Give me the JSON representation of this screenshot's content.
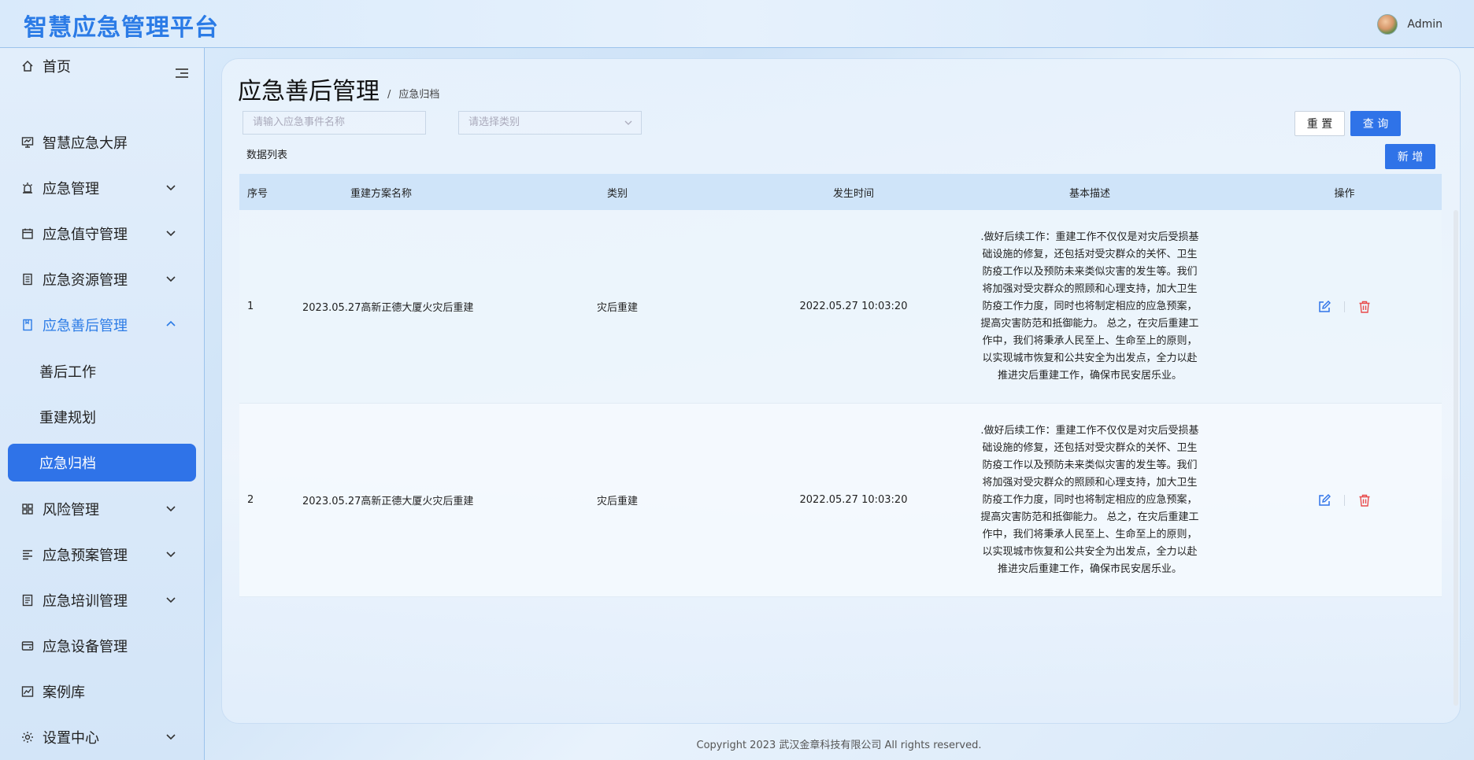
{
  "header": {
    "title": "智慧应急管理平台",
    "user": "Admin"
  },
  "sidebar": {
    "items": [
      {
        "label": "首页",
        "icon": "home-icon"
      },
      {
        "label": "智慧应急大屏",
        "icon": "dashboard-icon"
      },
      {
        "label": "应急管理",
        "icon": "alarm-icon"
      },
      {
        "label": "应急值守管理",
        "icon": "calendar-icon"
      },
      {
        "label": "应急资源管理",
        "icon": "document-icon"
      },
      {
        "label": "应急善后管理",
        "icon": "file-icon"
      },
      {
        "label": "风险管理",
        "icon": "grid-icon"
      },
      {
        "label": "应急预案管理",
        "icon": "list-icon"
      },
      {
        "label": "应急培训管理",
        "icon": "training-icon"
      },
      {
        "label": "应急设备管理",
        "icon": "device-icon"
      },
      {
        "label": "案例库",
        "icon": "chart-icon"
      },
      {
        "label": "设置中心",
        "icon": "gear-icon"
      }
    ],
    "sub_items": [
      "善后工作",
      "重建规划",
      "应急归档"
    ]
  },
  "main": {
    "title": "应急善后管理",
    "breadcrumb": "应急归档",
    "search_placeholder": "请输入应急事件名称",
    "type_placeholder": "请选择类别",
    "reset_label": "重 置",
    "query_label": "查 询",
    "add_label": "新 增",
    "list_label": "数据列表"
  },
  "table": {
    "headers": [
      "序号",
      "重建方案名称",
      "类别",
      "发生时间",
      "基本描述",
      "操作"
    ],
    "rows": [
      {
        "index": "1",
        "name": "2023.05.27高新正德大厦火灾后重建",
        "type": "灾后重建",
        "time": "2022.05.27 10:03:20",
        "desc": ".做好后续工作：重建工作不仅仅是对灾后受损基础设施的修复，还包括对受灾群众的关怀、卫生防疫工作以及预防未来类似灾害的发生等。我们将加强对受灾群众的照顾和心理支持，加大卫生防疫工作力度，同时也将制定相应的应急预案，提高灾害防范和抵御能力。 总之，在灾后重建工作中，我们将秉承人民至上、生命至上的原则，以实现城市恢复和公共安全为出发点，全力以赴推进灾后重建工作，确保市民安居乐业。"
      },
      {
        "index": "2",
        "name": "2023.05.27高新正德大厦火灾后重建",
        "type": "灾后重建",
        "time": "2022.05.27 10:03:20",
        "desc": ".做好后续工作：重建工作不仅仅是对灾后受损基础设施的修复，还包括对受灾群众的关怀、卫生防疫工作以及预防未来类似灾害的发生等。我们将加强对受灾群众的照顾和心理支持，加大卫生防疫工作力度，同时也将制定相应的应急预案，提高灾害防范和抵御能力。 总之，在灾后重建工作中，我们将秉承人民至上、生命至上的原则，以实现城市恢复和公共安全为出发点，全力以赴推进灾后重建工作，确保市民安居乐业。"
      }
    ]
  },
  "footer": "Copyright 2023 武汉金章科技有限公司 All rights reserved.",
  "colors": {
    "accent": "#2f73e8",
    "title": "#2b7be6"
  }
}
